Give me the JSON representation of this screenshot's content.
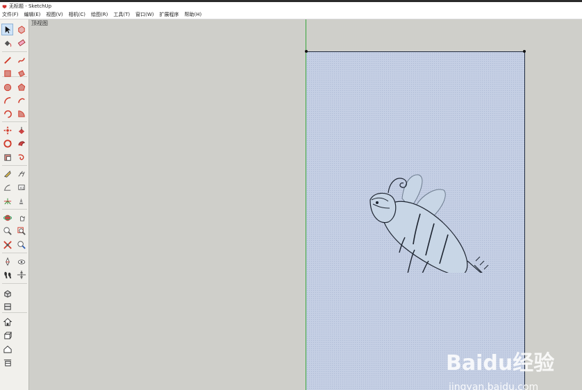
{
  "window": {
    "title": "无标题 - SketchUp"
  },
  "menu": {
    "items": [
      "文件(F)",
      "编辑(E)",
      "视图(V)",
      "相机(C)",
      "绘图(R)",
      "工具(T)",
      "窗口(W)",
      "扩展程序",
      "帮助(H)"
    ]
  },
  "toolbar": {
    "tools": [
      {
        "name": "select-tool-icon",
        "selected": true
      },
      {
        "name": "make-component-icon"
      },
      {
        "name": "paint-bucket-icon"
      },
      {
        "name": "eraser-icon"
      },
      {
        "name": "line-tool-icon"
      },
      {
        "name": "freehand-tool-icon"
      },
      {
        "name": "rectangle-tool-icon"
      },
      {
        "name": "rotated-rectangle-icon"
      },
      {
        "name": "circle-tool-icon"
      },
      {
        "name": "polygon-tool-icon"
      },
      {
        "name": "arc-tool-icon"
      },
      {
        "name": "two-point-arc-icon"
      },
      {
        "name": "three-point-arc-icon"
      },
      {
        "name": "pie-tool-icon"
      },
      {
        "name": "move-tool-icon"
      },
      {
        "name": "push-pull-icon"
      },
      {
        "name": "rotate-tool-icon"
      },
      {
        "name": "follow-me-icon"
      },
      {
        "name": "scale-tool-icon"
      },
      {
        "name": "offset-tool-icon"
      },
      {
        "name": "tape-measure-icon"
      },
      {
        "name": "dimension-tool-icon"
      },
      {
        "name": "protractor-icon"
      },
      {
        "name": "text-tool-icon"
      },
      {
        "name": "axes-tool-icon"
      },
      {
        "name": "3d-text-icon"
      },
      {
        "name": "orbit-tool-icon"
      },
      {
        "name": "pan-tool-icon"
      },
      {
        "name": "zoom-tool-icon"
      },
      {
        "name": "zoom-window-icon"
      },
      {
        "name": "zoom-extents-icon"
      },
      {
        "name": "previous-view-icon"
      },
      {
        "name": "position-camera-icon"
      },
      {
        "name": "look-around-icon"
      },
      {
        "name": "walk-tool-icon"
      },
      {
        "name": "section-plane-icon"
      },
      {
        "name": "iso-view-icon"
      },
      {
        "name": "top-view-icon"
      },
      {
        "name": "front-view-icon"
      },
      {
        "name": "right-view-icon"
      },
      {
        "name": "back-view-icon"
      },
      {
        "name": "left-view-icon"
      }
    ],
    "accent": "#d03a2a"
  },
  "viewport": {
    "view_label": "顶视图",
    "plane_color": "#c5cfe4",
    "axis_color": "#37a63c"
  },
  "watermark": {
    "brand": "Baidu经验",
    "url": "jingyan.baidu.com"
  }
}
